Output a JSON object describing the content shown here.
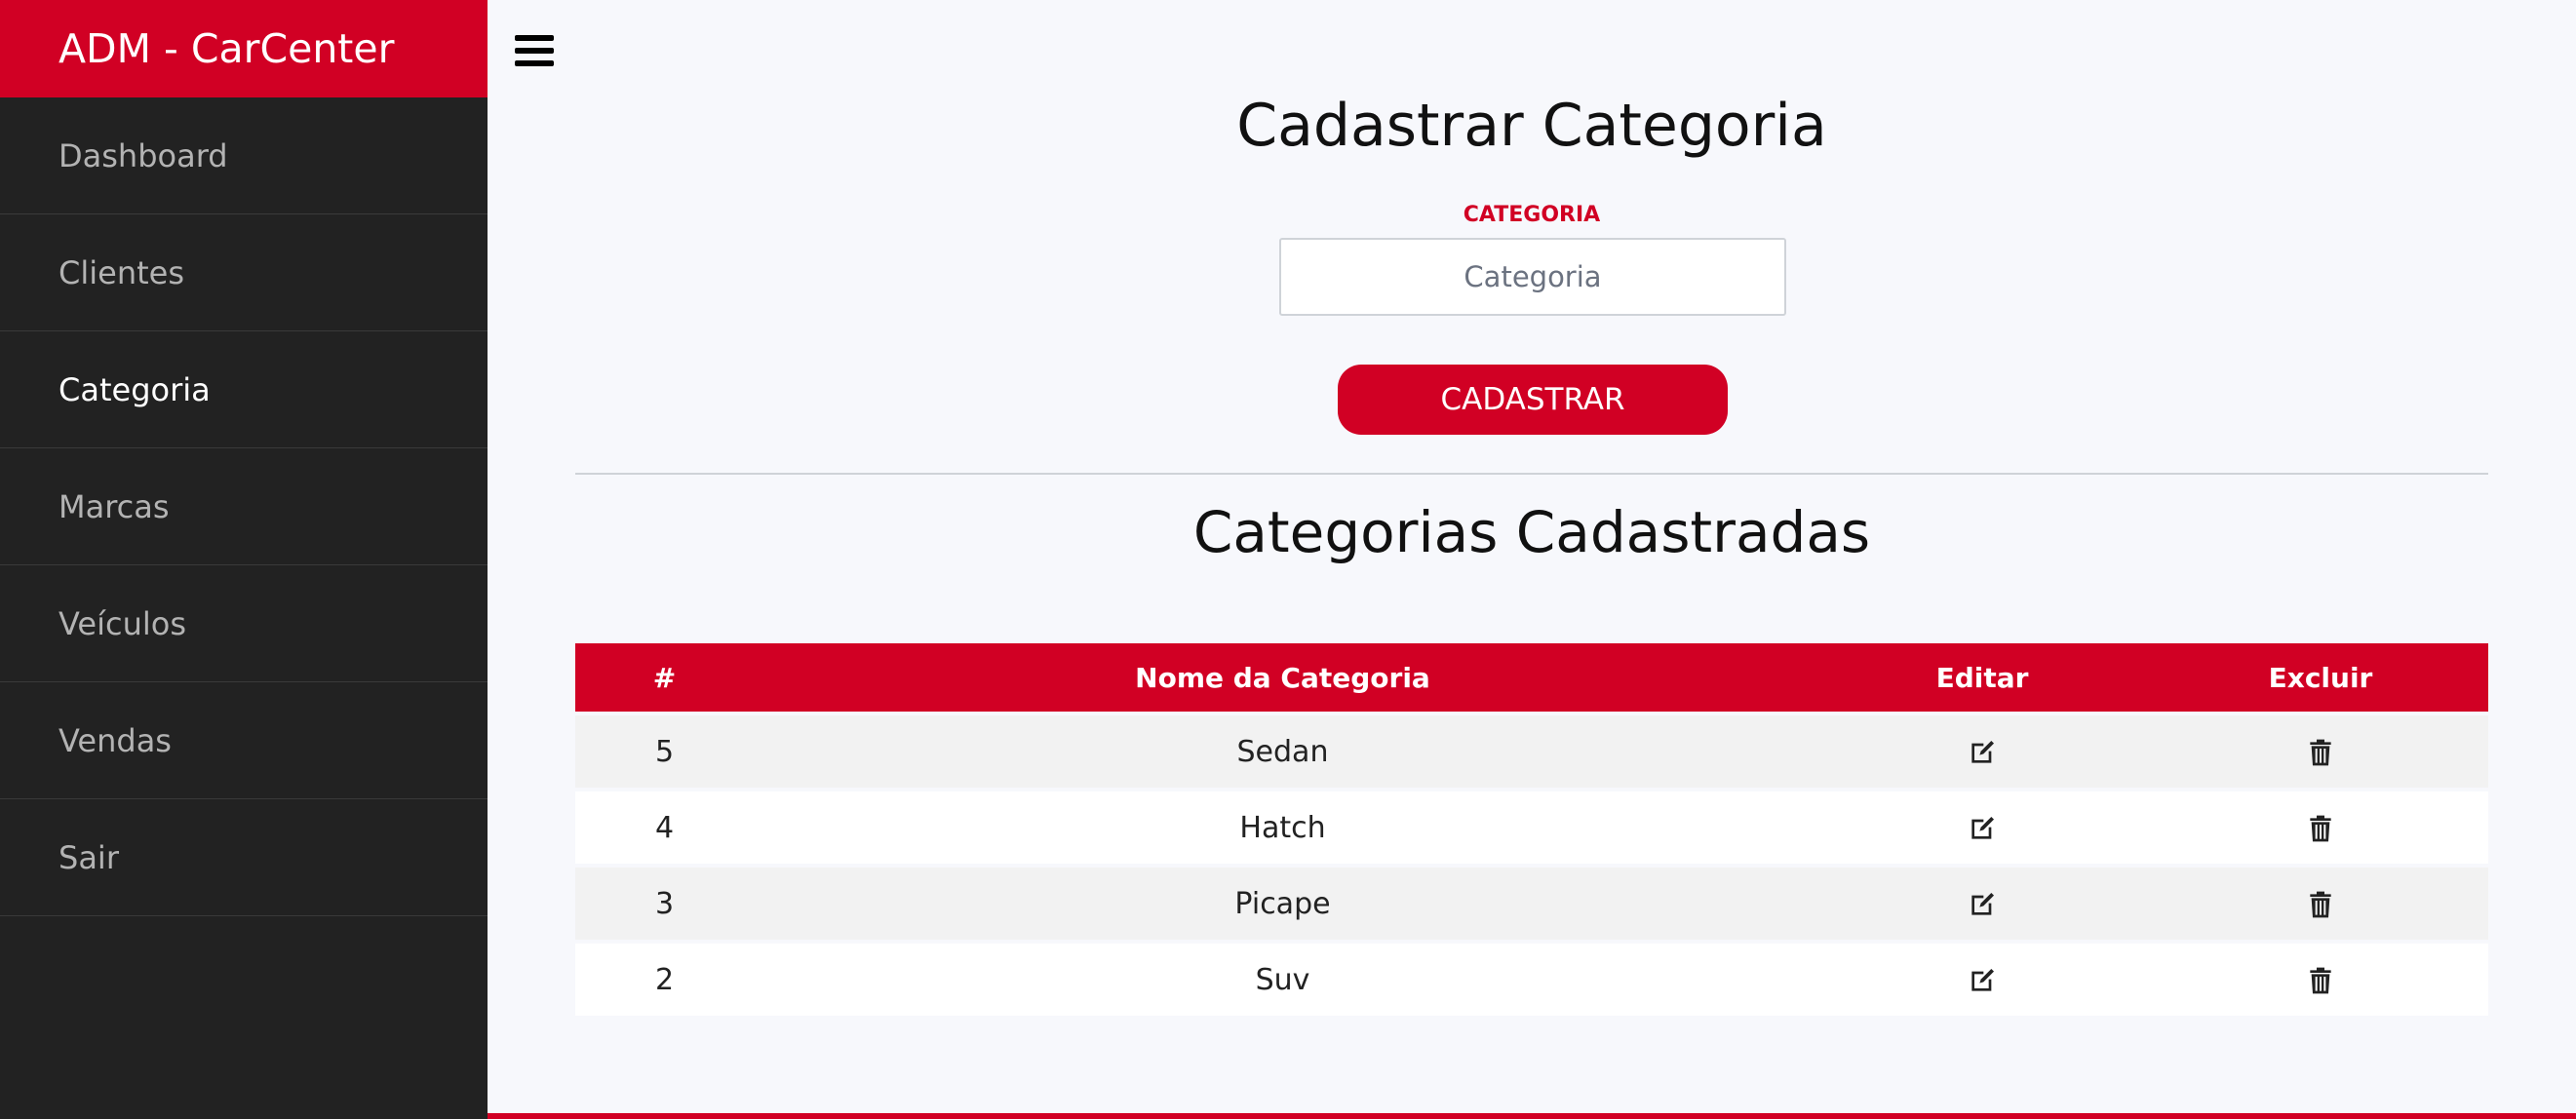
{
  "app": {
    "brand": "ADM - CarCenter"
  },
  "sidebar": {
    "items": [
      {
        "label": "Dashboard",
        "active": false
      },
      {
        "label": "Clientes",
        "active": false
      },
      {
        "label": "Categoria",
        "active": true
      },
      {
        "label": "Marcas",
        "active": false
      },
      {
        "label": "Veículos",
        "active": false
      },
      {
        "label": "Vendas",
        "active": false
      },
      {
        "label": "Sair",
        "active": false
      }
    ]
  },
  "header": {
    "menu_icon": "hamburger-menu-icon"
  },
  "form": {
    "title": "Cadastrar Categoria",
    "field_label": "CATEGORIA",
    "placeholder": "Categoria",
    "value": "",
    "submit_label": "CADASTRAR"
  },
  "list": {
    "title": "Categorias Cadastradas",
    "columns": [
      "#",
      "Nome da Categoria",
      "Editar",
      "Excluir"
    ],
    "rows": [
      {
        "id": "5",
        "name": "Sedan"
      },
      {
        "id": "4",
        "name": "Hatch"
      },
      {
        "id": "3",
        "name": "Picape"
      },
      {
        "id": "2",
        "name": "Suv"
      }
    ],
    "edit_icon": "edit-icon",
    "delete_icon": "trash-icon"
  },
  "colors": {
    "accent": "#d10024",
    "sidebar_bg": "#222222",
    "page_bg": "#f7f8fc"
  }
}
